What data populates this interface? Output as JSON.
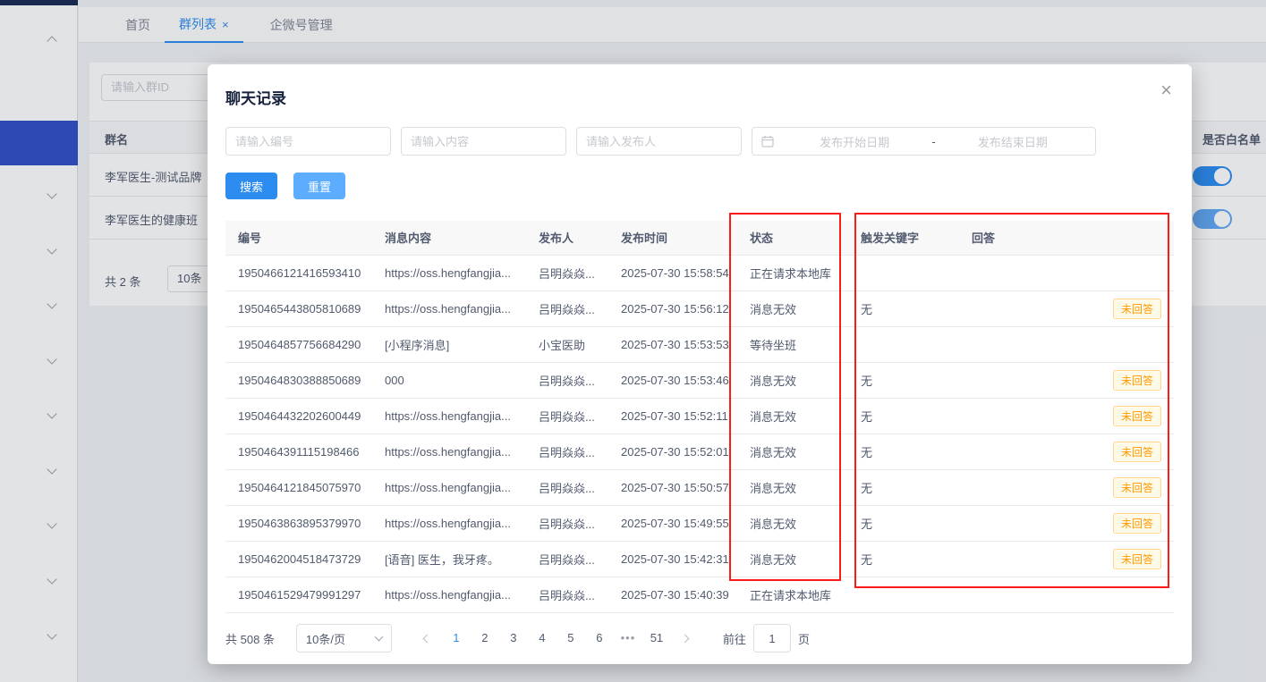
{
  "sidebar": {
    "selected_color": "#3450c8"
  },
  "tabs": {
    "home": "首页",
    "group_list": "群列表",
    "wecom": "企微号管理",
    "close_glyph": "×"
  },
  "background": {
    "group_search_placeholder": "请输入群ID",
    "table": {
      "col_group_name": "群名",
      "col_whitelist": "是否白名单",
      "rows": [
        {
          "name": "李军医生-测试品牌",
          "whitelist_on": true,
          "disabled": false
        },
        {
          "name": "李军医生的健康班",
          "whitelist_on": true,
          "disabled": true
        }
      ],
      "total_text": "共 2 条",
      "page_size": "10条"
    }
  },
  "modal": {
    "title": "聊天记录",
    "close_glyph": "×",
    "filters": {
      "id_placeholder": "请输入编号",
      "content_placeholder": "请输入内容",
      "publisher_placeholder": "请输入发布人",
      "date_start_placeholder": "发布开始日期",
      "date_separator": "-",
      "date_end_placeholder": "发布结束日期"
    },
    "buttons": {
      "search": "搜索",
      "reset": "重置"
    },
    "table": {
      "columns": [
        "编号",
        "消息内容",
        "发布人",
        "发布时间",
        "状态",
        "触发关键字",
        "回答"
      ],
      "unanswered_tag": "未回答",
      "rows": [
        {
          "id": "1950466121416593410",
          "content": "https://oss.hengfangjia...",
          "publisher": "吕明焱焱...",
          "time": "2025-07-30 15:58:54",
          "status": "正在请求本地库",
          "keyword": "",
          "answer_tag": ""
        },
        {
          "id": "1950465443805810689",
          "content": "https://oss.hengfangjia...",
          "publisher": "吕明焱焱...",
          "time": "2025-07-30 15:56:12",
          "status": "消息无效",
          "keyword": "无",
          "answer_tag": "未回答"
        },
        {
          "id": "1950464857756684290",
          "content": "[小程序消息]",
          "publisher": "小宝医助",
          "time": "2025-07-30 15:53:53",
          "status": "等待坐班",
          "keyword": "",
          "answer_tag": ""
        },
        {
          "id": "1950464830388850689",
          "content": "000",
          "publisher": "吕明焱焱...",
          "time": "2025-07-30 15:53:46",
          "status": "消息无效",
          "keyword": "无",
          "answer_tag": "未回答"
        },
        {
          "id": "1950464432202600449",
          "content": "https://oss.hengfangjia...",
          "publisher": "吕明焱焱...",
          "time": "2025-07-30 15:52:11",
          "status": "消息无效",
          "keyword": "无",
          "answer_tag": "未回答"
        },
        {
          "id": "1950464391115198466",
          "content": "https://oss.hengfangjia...",
          "publisher": "吕明焱焱...",
          "time": "2025-07-30 15:52:01",
          "status": "消息无效",
          "keyword": "无",
          "answer_tag": "未回答"
        },
        {
          "id": "1950464121845075970",
          "content": "https://oss.hengfangjia...",
          "publisher": "吕明焱焱...",
          "time": "2025-07-30 15:50:57",
          "status": "消息无效",
          "keyword": "无",
          "answer_tag": "未回答"
        },
        {
          "id": "1950463863895379970",
          "content": "https://oss.hengfangjia...",
          "publisher": "吕明焱焱...",
          "time": "2025-07-30 15:49:55",
          "status": "消息无效",
          "keyword": "无",
          "answer_tag": "未回答"
        },
        {
          "id": "1950462004518473729",
          "content": "[语音] 医生，我牙疼。",
          "publisher": "吕明焱焱...",
          "time": "2025-07-30 15:42:31",
          "status": "消息无效",
          "keyword": "无",
          "answer_tag": "未回答"
        },
        {
          "id": "1950461529479991297",
          "content": "https://oss.hengfangjia...",
          "publisher": "吕明焱焱...",
          "time": "2025-07-30 15:40:39",
          "status": "正在请求本地库",
          "keyword": "",
          "answer_tag": ""
        }
      ]
    },
    "highlight_color": "#ff1a1a",
    "pagination": {
      "total": "共 508 条",
      "page_size": "10条/页",
      "pages": [
        "1",
        "2",
        "3",
        "4",
        "5",
        "6",
        "•••",
        "51"
      ],
      "active_page": "1",
      "goto_label": "前往",
      "goto_value": "1",
      "goto_suffix": "页"
    }
  }
}
